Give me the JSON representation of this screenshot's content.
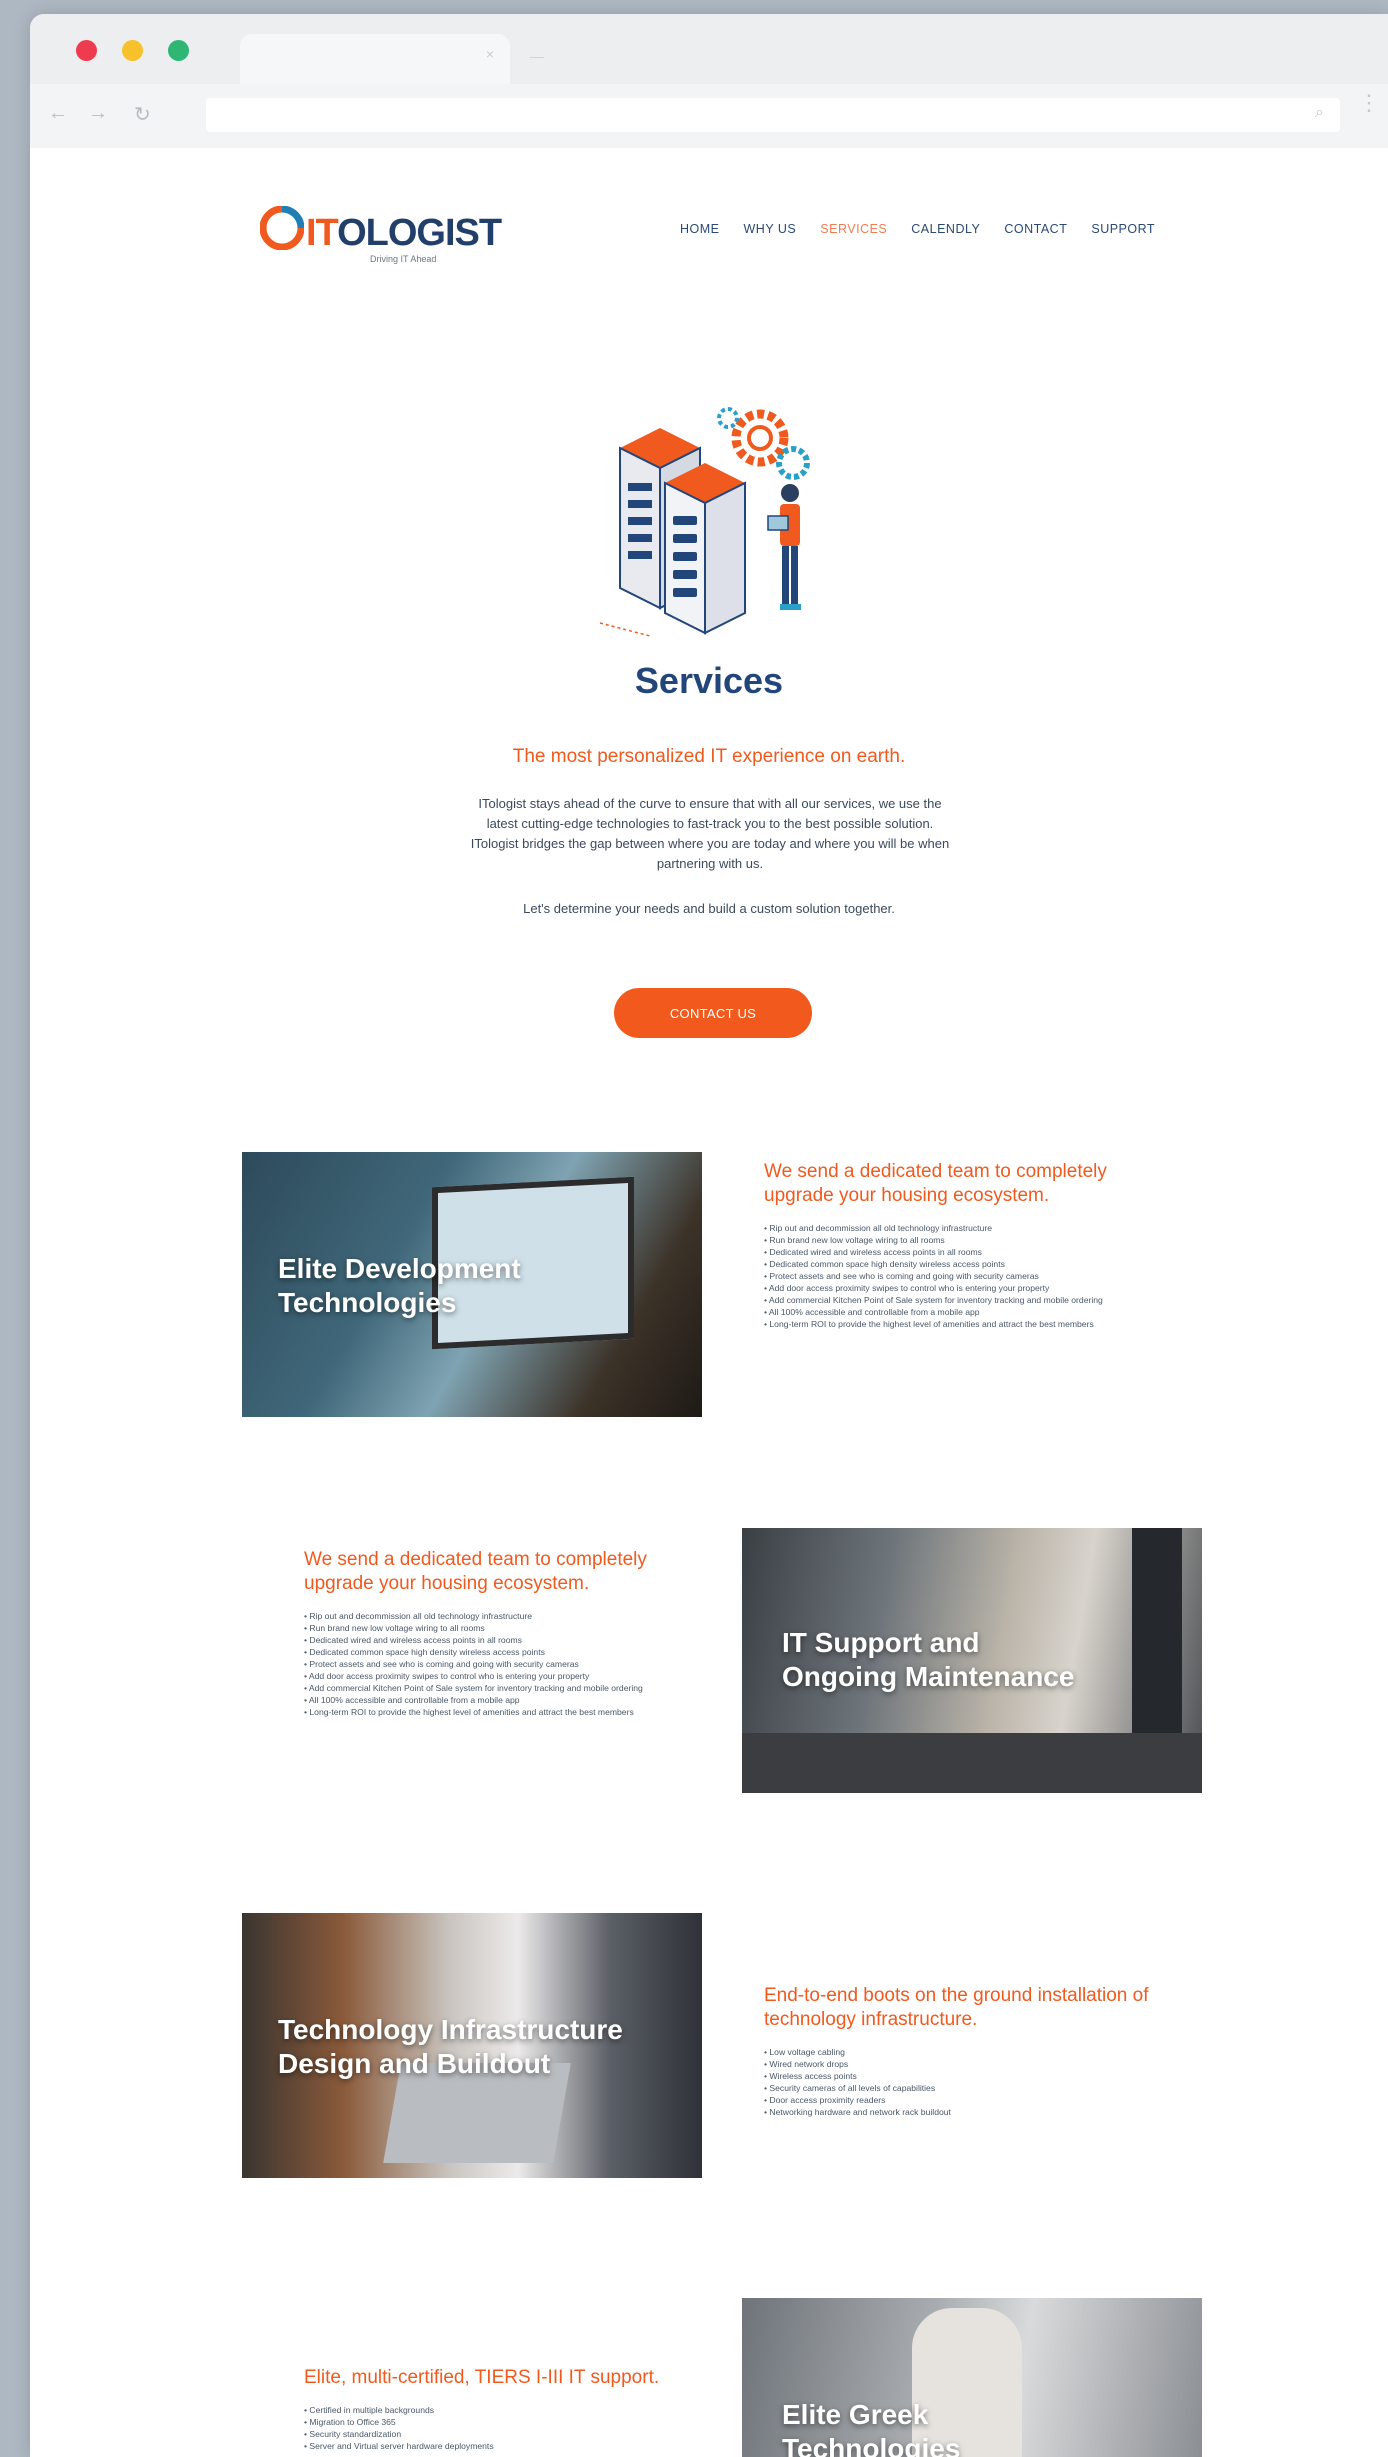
{
  "browser": {
    "tab_close": "×",
    "tab_ghost": "—",
    "nav_back": "←",
    "nav_forward": "→",
    "nav_reload": "↻",
    "search_glyph": "⌕",
    "menu_glyph": "⋮"
  },
  "header": {
    "logo_it": "IT",
    "logo_rest": "OLOGIST",
    "logo_tagline": "Driving IT Ahead"
  },
  "nav": {
    "items": [
      "HOME",
      "WHY US",
      "SERVICES",
      "CALENDLY",
      "CONTACT",
      "SUPPORT"
    ],
    "active": "SERVICES"
  },
  "hero": {
    "title": "Services",
    "tagline": "The most personalized IT experience on earth.",
    "intro": "ITologist stays ahead of the curve to ensure that with all our services, we use the latest cutting-edge technologies to fast-track you to the best possible solution. ITologist bridges the gap between where you are today and where you will be when partnering with us.",
    "intro2": "Let's determine your needs and build a custom solution together.",
    "cta_label": "CONTACT US"
  },
  "sections": [
    {
      "photo_title": [
        "Elite Development",
        "Technologies"
      ],
      "heading": "We send a dedicated team to completely upgrade your housing ecosystem.",
      "bullets": [
        "• Rip out and decommission all old technology infrastructure",
        "• Run brand new low voltage wiring to all rooms",
        "• Dedicated wired and wireless access points in all rooms",
        "• Dedicated common space high density wireless access points",
        "• Protect assets and see who is coming and going with security cameras",
        "• Add door access proximity swipes to control who is entering your property",
        "• Add commercial Kitchen Point of Sale system for inventory tracking and mobile ordering",
        "• All 100% accessible and controllable from a mobile app",
        "• Long-term ROI to provide the highest level of amenities and attract the best members"
      ]
    },
    {
      "photo_title": [
        "IT Support and",
        "Ongoing Maintenance"
      ],
      "heading": "We send a dedicated team to completely upgrade your housing ecosystem.",
      "bullets": [
        "• Rip out and decommission all old technology infrastructure",
        "• Run brand new low voltage wiring to all rooms",
        "• Dedicated wired and wireless access points in all rooms",
        "• Dedicated common space high density wireless access points",
        "• Protect assets and see who is coming and going with security cameras",
        "• Add door access proximity swipes to control who is entering your property",
        "• Add commercial Kitchen Point of Sale system for inventory tracking and mobile ordering",
        "• All 100% accessible and controllable from a mobile app",
        "• Long-term ROI to provide the highest level of amenities and attract the best members"
      ]
    },
    {
      "photo_title": [
        "Technology Infrastructure",
        "Design and Buildout"
      ],
      "heading": "End-to-end boots on the ground installation of technology infrastructure.",
      "bullets": [
        "• Low voltage cabling",
        "• Wired network drops",
        "• Wireless access points",
        "• Security cameras of all levels of capabilities",
        "• Door access proximity readers",
        "• Networking hardware and network rack buildout"
      ]
    },
    {
      "photo_title": [
        "Elite Greek",
        "Technologies"
      ],
      "heading": "Elite, multi-certified, TIERS I-III IT support.",
      "bullets": [
        "• Certified in multiple backgrounds",
        "• Migration to Office 365",
        "• Security standardization",
        "• Server and Virtual server hardware deployments"
      ]
    }
  ],
  "colors": {
    "brand_orange": "#f05a1e",
    "brand_navy": "#22457a"
  }
}
